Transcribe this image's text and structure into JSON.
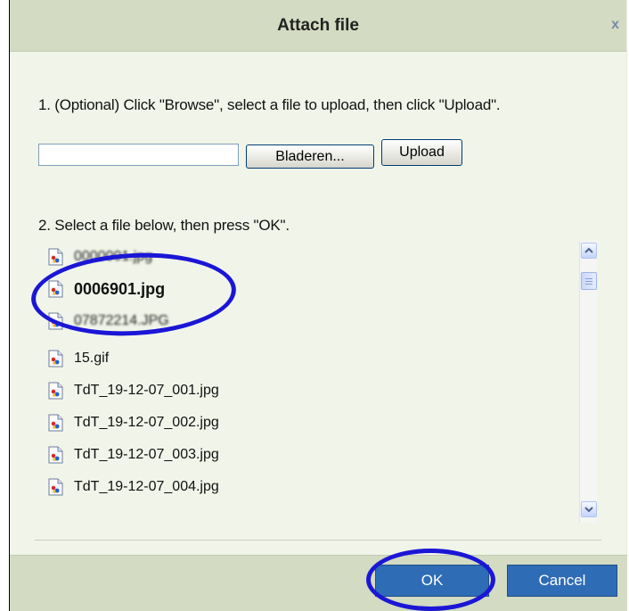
{
  "dialog": {
    "title": "Attach file",
    "close_glyph": "x",
    "step1_text": "1. (Optional) Click \"Browse\", select a file to upload, then click \"Upload\".",
    "upload_field_value": "",
    "browse_label": "Bladeren...",
    "upload_label": "Upload",
    "step2_text": "2. Select a file below, then press \"OK\".",
    "files": [
      {
        "name": "0000001.jpg",
        "selected": false,
        "obscured": true
      },
      {
        "name": "0006901.jpg",
        "selected": true,
        "obscured": false
      },
      {
        "name": "07872214.JPG",
        "selected": false,
        "obscured": true
      },
      {
        "name": "15.gif",
        "selected": false,
        "obscured": false
      },
      {
        "name": "TdT_19-12-07_001.jpg",
        "selected": false,
        "obscured": false
      },
      {
        "name": "TdT_19-12-07_002.jpg",
        "selected": false,
        "obscured": false
      },
      {
        "name": "TdT_19-12-07_003.jpg",
        "selected": false,
        "obscured": false
      },
      {
        "name": "TdT_19-12-07_004.jpg",
        "selected": false,
        "obscured": false
      }
    ],
    "file_icon": "image-file-icon",
    "ok_label": "OK",
    "cancel_label": "Cancel"
  },
  "colors": {
    "titlebar": "#d3dbc2",
    "body": "#f1f5e9",
    "button_blue": "#2e6cb5",
    "annotation": "#1b16d6"
  }
}
